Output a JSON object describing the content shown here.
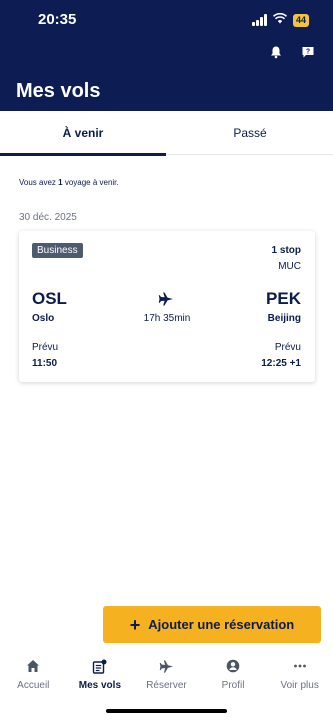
{
  "status": {
    "time": "20:35",
    "battery": "44"
  },
  "header": {
    "title": "Mes vols",
    "icons": [
      "bell-icon",
      "help-icon"
    ]
  },
  "tabs": [
    {
      "label": "À venir",
      "active": true
    },
    {
      "label": "Passé",
      "active": false
    }
  ],
  "summary": {
    "prefix": "Vous avez ",
    "count": "1",
    "suffix": " voyage à venir."
  },
  "trips": [
    {
      "date": "30 déc. 2025",
      "cabin": "Business",
      "stops": "1 stop",
      "via": "MUC",
      "from_code": "OSL",
      "from_city": "Oslo",
      "to_code": "PEK",
      "to_city": "Beijing",
      "duration": "17h 35min",
      "dep_label": "Prévu",
      "dep_time": "11:50",
      "arr_label": "Prévu",
      "arr_time": "12:25 +1"
    }
  ],
  "add_button": {
    "label": "Ajouter une réservation"
  },
  "nav": [
    {
      "label": "Accueil",
      "icon": "home-icon",
      "active": false
    },
    {
      "label": "Mes vols",
      "icon": "booking-icon",
      "active": true
    },
    {
      "label": "Réserver",
      "icon": "plane-icon",
      "active": false
    },
    {
      "label": "Profil",
      "icon": "profile-icon",
      "active": false
    },
    {
      "label": "Voir plus",
      "icon": "more-icon",
      "active": false
    }
  ],
  "colors": {
    "header": "#0d1c52",
    "accent": "#f5b11f",
    "text": "#0b1c4d"
  }
}
